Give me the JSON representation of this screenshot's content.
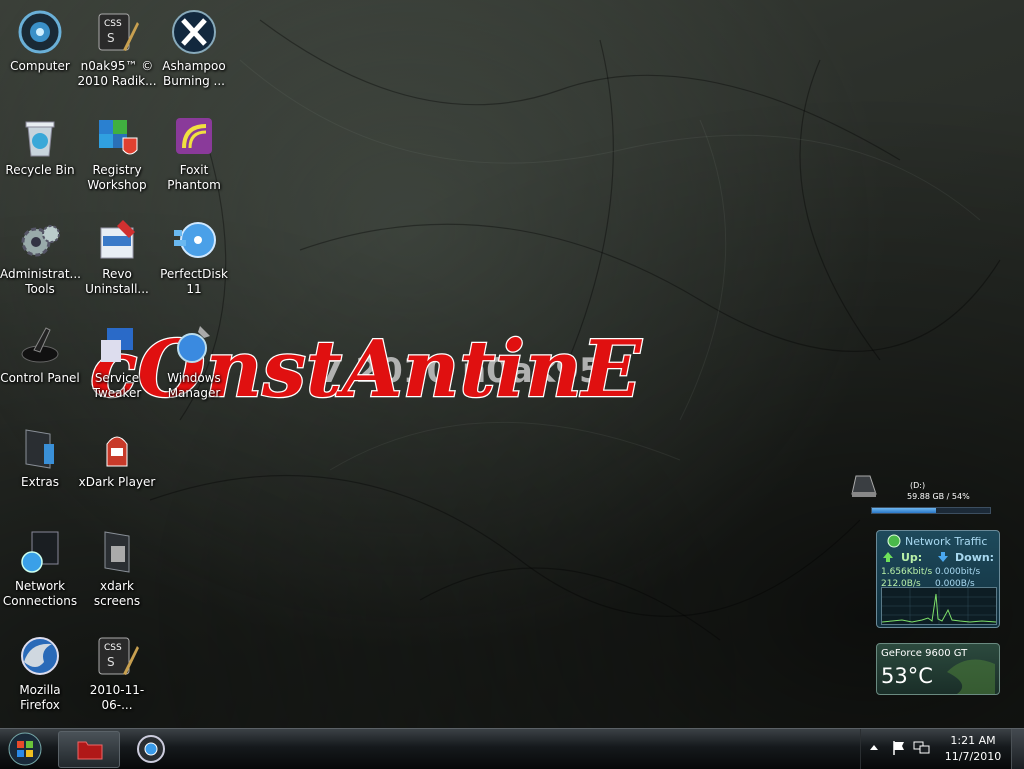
{
  "desktop": {
    "icons": [
      {
        "label": "Computer",
        "icon": "computer-icon"
      },
      {
        "label": "n0ak95™ © 2010 Radik...",
        "icon": "css-file-icon"
      },
      {
        "label": "Ashampoo Burning ...",
        "icon": "ashampoo-icon"
      },
      {
        "label": "Recycle Bin",
        "icon": "recycle-bin-icon"
      },
      {
        "label": "Registry Workshop",
        "icon": "registry-workshop-icon"
      },
      {
        "label": "Foxit Phantom",
        "icon": "foxit-phantom-icon"
      },
      {
        "label": "Administrat... Tools",
        "icon": "admin-tools-icon"
      },
      {
        "label": "Revo Uninstall...",
        "icon": "revo-uninstaller-icon"
      },
      {
        "label": "PerfectDisk 11",
        "icon": "perfectdisk-icon"
      },
      {
        "label": "Control Panel",
        "icon": "control-panel-icon"
      },
      {
        "label": "Service Tweaker",
        "icon": "service-tweaker-icon"
      },
      {
        "label": "Windows Manager",
        "icon": "windows-manager-icon"
      },
      {
        "label": "Extras",
        "icon": "folder-icon"
      },
      {
        "label": "xDark Player",
        "icon": "xdark-player-icon"
      },
      {
        "label": "Network Connections",
        "icon": "network-connections-icon"
      },
      {
        "label": "xdark screens",
        "icon": "folder-icon"
      },
      {
        "label": "Mozilla Firefox",
        "icon": "firefox-icon"
      },
      {
        "label": "2010-11-06-...",
        "icon": "css-file-icon"
      }
    ],
    "watermark": {
      "text": "cOnstAntinE",
      "behind_text": "7 2010 n0ak95"
    }
  },
  "gadgets": {
    "drive": {
      "name": "(D:)",
      "info": "59.88 GB / 54%",
      "used_fraction": 0.54
    },
    "network": {
      "title": "Network Traffic",
      "up_label": "Up:",
      "down_label": "Down:",
      "up_bits": "1.656Kbit/s",
      "down_bits": "0.000bit/s",
      "up_bytes": "212.0B/s",
      "down_bytes": "0.000B/s"
    },
    "gpu": {
      "name": "GeForce 9600 GT",
      "temp": "53°C"
    }
  },
  "taskbar": {
    "clock_time": "1:21 AM",
    "clock_date": "11/7/2010"
  },
  "colors": {
    "watermark_red": "#e01010",
    "accent_blue": "#3a8ee0"
  }
}
